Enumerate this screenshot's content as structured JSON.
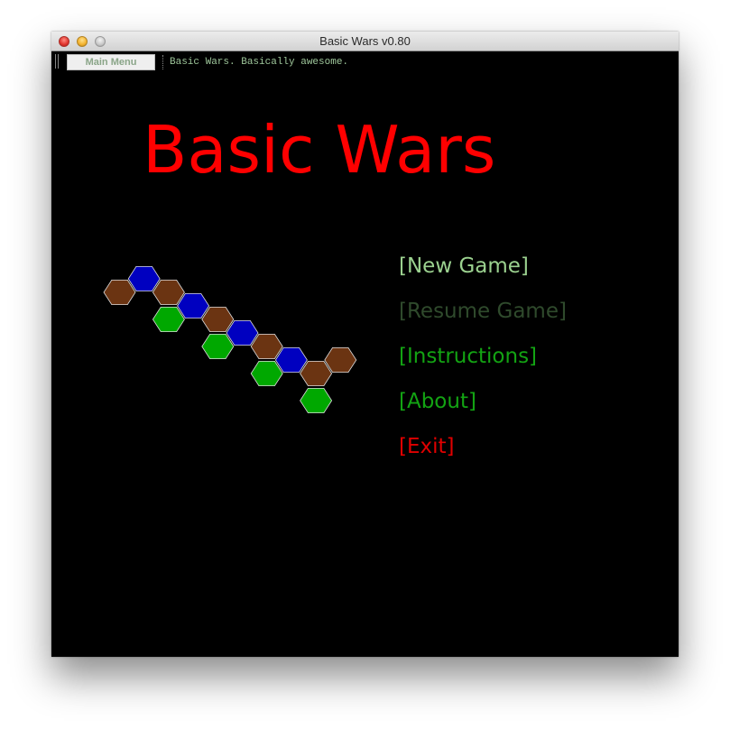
{
  "window": {
    "title": "Basic Wars v0.80"
  },
  "toolbar": {
    "tab_label": "Main Menu",
    "status": "Basic Wars. Basically awesome."
  },
  "game": {
    "title": "Basic Wars",
    "title_color": "#ff0000"
  },
  "menu": {
    "items": [
      {
        "label": "[New Game]",
        "color": "#9bd18f",
        "enabled": true
      },
      {
        "label": "[Resume Game]",
        "color": "#2f4a2c",
        "enabled": false
      },
      {
        "label": "[Instructions]",
        "color": "#13a313",
        "enabled": true
      },
      {
        "label": "[About]",
        "color": "#13a313",
        "enabled": true
      },
      {
        "label": "[Exit]",
        "color": "#e00000",
        "enabled": true
      }
    ]
  },
  "hex_colors": {
    "brown": "#6b3412",
    "blue": "#0000c0",
    "green": "#00a800",
    "outline": "#dcdcdc"
  },
  "hex_tiles": [
    {
      "col": 0,
      "row": 0,
      "type": "brown"
    },
    {
      "col": 1,
      "row": 0,
      "type": "blue"
    },
    {
      "col": 2,
      "row": 0,
      "type": "brown"
    },
    {
      "col": 2,
      "row": 1,
      "type": "green"
    },
    {
      "col": 3,
      "row": 1,
      "type": "blue"
    },
    {
      "col": 4,
      "row": 1,
      "type": "brown"
    },
    {
      "col": 4,
      "row": 2,
      "type": "green"
    },
    {
      "col": 5,
      "row": 2,
      "type": "blue"
    },
    {
      "col": 6,
      "row": 2,
      "type": "brown"
    },
    {
      "col": 6,
      "row": 3,
      "type": "green"
    },
    {
      "col": 7,
      "row": 3,
      "type": "blue"
    },
    {
      "col": 8,
      "row": 3,
      "type": "brown"
    },
    {
      "col": 9,
      "row": 3,
      "type": "brown"
    },
    {
      "col": 8,
      "row": 4,
      "type": "green"
    }
  ]
}
